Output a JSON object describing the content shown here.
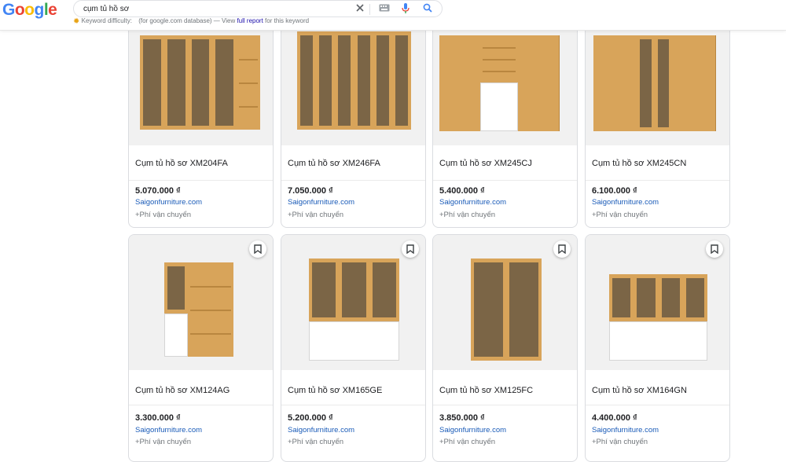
{
  "search": {
    "query": "cụm tủ hồ sơ",
    "keyword_label": "Keyword difficulty:",
    "keyword_source": "(for google.com database) — View",
    "keyword_link": "full report",
    "keyword_tail": "for this keyword"
  },
  "logo": {
    "letters": [
      "G",
      "o",
      "o",
      "g",
      "l",
      "e"
    ],
    "colors": [
      "#4285F4",
      "#EA4335",
      "#FBBC05",
      "#4285F4",
      "#34A853",
      "#EA4335"
    ]
  },
  "icons": {
    "clear": "close-icon",
    "keyboard": "keyboard-icon",
    "voice": "microphone-icon",
    "search": "search-icon",
    "save": "bookmark-icon"
  },
  "colors": {
    "link": "#1a5bb8",
    "wood": "#d8a45a",
    "wood_dark": "#b9863f",
    "glass": "#6b5a43",
    "white_door": "#ffffff"
  },
  "products": [
    {
      "title": "Cụm tủ hồ sơ XM204FA",
      "price": "5.070.000 ₫",
      "merchant": "Saigonfurniture.com",
      "shipping": "+Phí vận chuyển"
    },
    {
      "title": "Cụm tủ hồ sơ XM246FA",
      "price": "7.050.000 ₫",
      "merchant": "Saigonfurniture.com",
      "shipping": "+Phí vận chuyển"
    },
    {
      "title": "Cụm tủ hồ sơ XM245CJ",
      "price": "5.400.000 ₫",
      "merchant": "Saigonfurniture.com",
      "shipping": "+Phí vận chuyển"
    },
    {
      "title": "Cụm tủ hồ sơ XM245CN",
      "price": "6.100.000 ₫",
      "merchant": "Saigonfurniture.com",
      "shipping": "+Phí vận chuyển"
    },
    {
      "title": "Cụm tủ hồ sơ XM124AG",
      "price": "3.300.000 ₫",
      "merchant": "Saigonfurniture.com",
      "shipping": "+Phí vận chuyển"
    },
    {
      "title": "Cụm tủ hồ sơ XM165GE",
      "price": "5.200.000 ₫",
      "merchant": "Saigonfurniture.com",
      "shipping": "+Phí vận chuyển"
    },
    {
      "title": "Cụm tủ hồ sơ XM125FC",
      "price": "3.850.000 ₫",
      "merchant": "Saigonfurniture.com",
      "shipping": "+Phí vận chuyển"
    },
    {
      "title": "Cụm tủ hồ sơ XM164GN",
      "price": "4.400.000 ₫",
      "merchant": "Saigonfurniture.com",
      "shipping": "+Phí vận chuyển"
    }
  ]
}
